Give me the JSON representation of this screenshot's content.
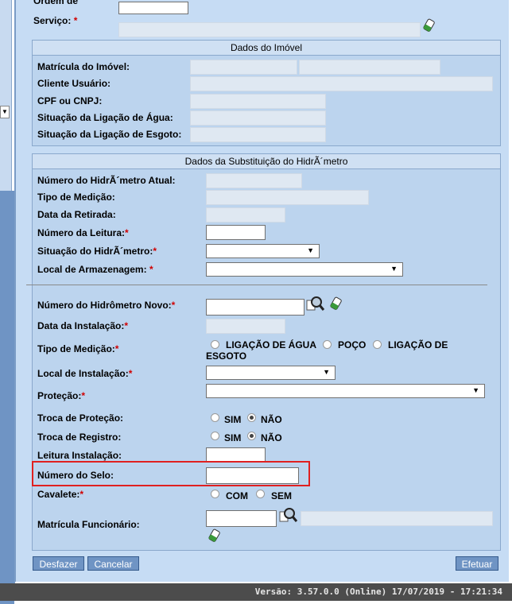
{
  "top": {
    "ordem_label_partial": "Ordem de",
    "servico_label": "Serviço:",
    "servico_required": "*"
  },
  "dados_imovel": {
    "header": "Dados do Imóvel",
    "matricula_label": "Matrícula do Imóvel:",
    "cliente_label": "Cliente Usuário:",
    "cpf_label": "CPF ou CNPJ:",
    "sit_agua_label": "Situação da Ligação de Água:",
    "sit_esgoto_label": "Situação da Ligação de Esgoto:"
  },
  "dados_substituicao": {
    "header": "Dados da Substituição do HidrÃ´metro",
    "numero_atual_label": "Número do HidrÃ´metro Atual:",
    "tipo_medicao_label": "Tipo de Medição:",
    "data_retirada_label": "Data da Retirada:",
    "numero_leitura_label": "Número da Leitura:",
    "situacao_label": "Situação do HidrÃ´metro:",
    "local_armaz_label": "Local de Armazenagem:",
    "numero_novo_label": "Número do Hidrômetro Novo:",
    "data_instalacao_label": "Data da Instalação:",
    "tipo_medicao2_label": "Tipo de Medição:",
    "tipo_medicao_options": [
      "LIGAÇÃO DE ÁGUA",
      "POÇO",
      "LIGAÇÃO DE",
      "ESGOTO"
    ],
    "local_instalacao_label": "Local de Instalação:",
    "protecao_label": "Proteção:",
    "troca_protecao_label": "Troca de Proteção:",
    "troca_registro_label": "Troca de Registro:",
    "sim_label": "SIM",
    "nao_label": "NÃO",
    "leitura_instalacao_label": "Leitura Instalação:",
    "numero_selo_label": "Número do Selo:",
    "cavalete_label": "Cavalete:",
    "com_label": "COM",
    "sem_label": "SEM",
    "matricula_func_label": "Matrícula Funcionário:",
    "required_mark": "*"
  },
  "buttons": {
    "desfazer": "Desfazer",
    "cancelar": "Cancelar",
    "efetuar": "Efetuar"
  },
  "footer": {
    "version_text": "Versão: 3.57.0.0 (Online) 17/07/2019 - 17:21:34"
  },
  "colors": {
    "panel_bg": "#c6dcf4",
    "button_bg": "#6f94c4",
    "highlight": "#e02020",
    "footer_bg": "#4c4c4c"
  },
  "icons": [
    "search-icon",
    "eraser-icon"
  ]
}
